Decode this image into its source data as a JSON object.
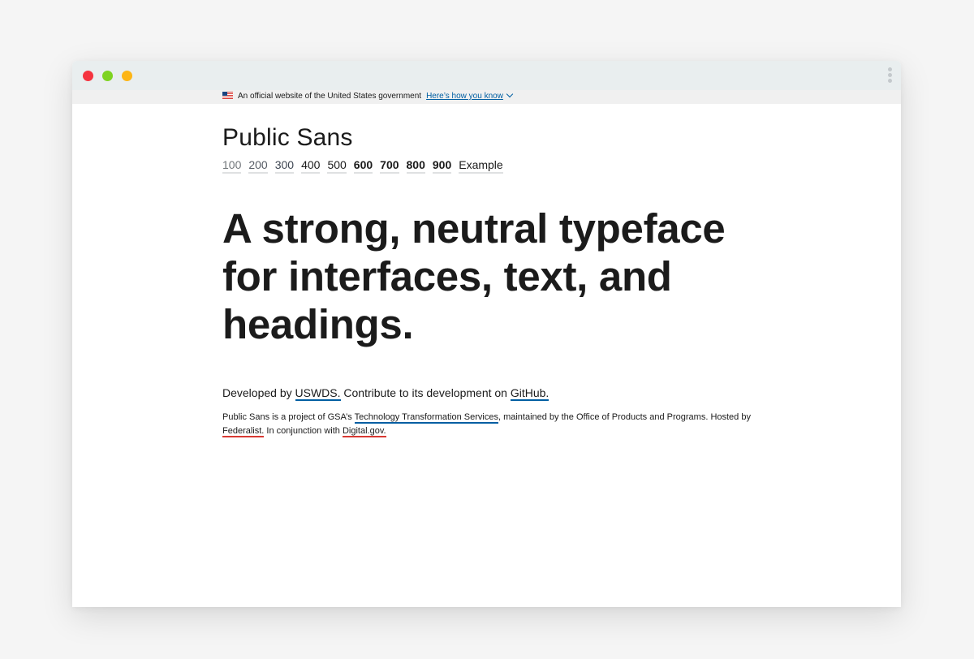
{
  "gov_banner": {
    "text": "An official website of the United States government",
    "link": "Here’s how you know"
  },
  "site_title": "Public Sans",
  "weights": [
    "100",
    "200",
    "300",
    "400",
    "500",
    "600",
    "700",
    "800",
    "900",
    "Example"
  ],
  "headline": "A strong, neutral typeface for interfaces, text, and headings.",
  "dev_line": {
    "prefix": "Developed by ",
    "uswds": "USWDS.",
    "middle": " Contribute to its development on ",
    "github": "GitHub."
  },
  "footnote": {
    "part1": "Public Sans is a project of GSA’s ",
    "tts": "Technology Transformation Services",
    "part2": ", maintained by the Office of Products and Programs. Hosted by ",
    "federalist": "Federalist.",
    "part3": " In conjunction with ",
    "digitalgov": "Digital.gov."
  },
  "colors": {
    "link_blue": "#005ea2",
    "link_red": "#d83933",
    "text": "#1b1b1b",
    "titlebar": "#e9eeef"
  }
}
